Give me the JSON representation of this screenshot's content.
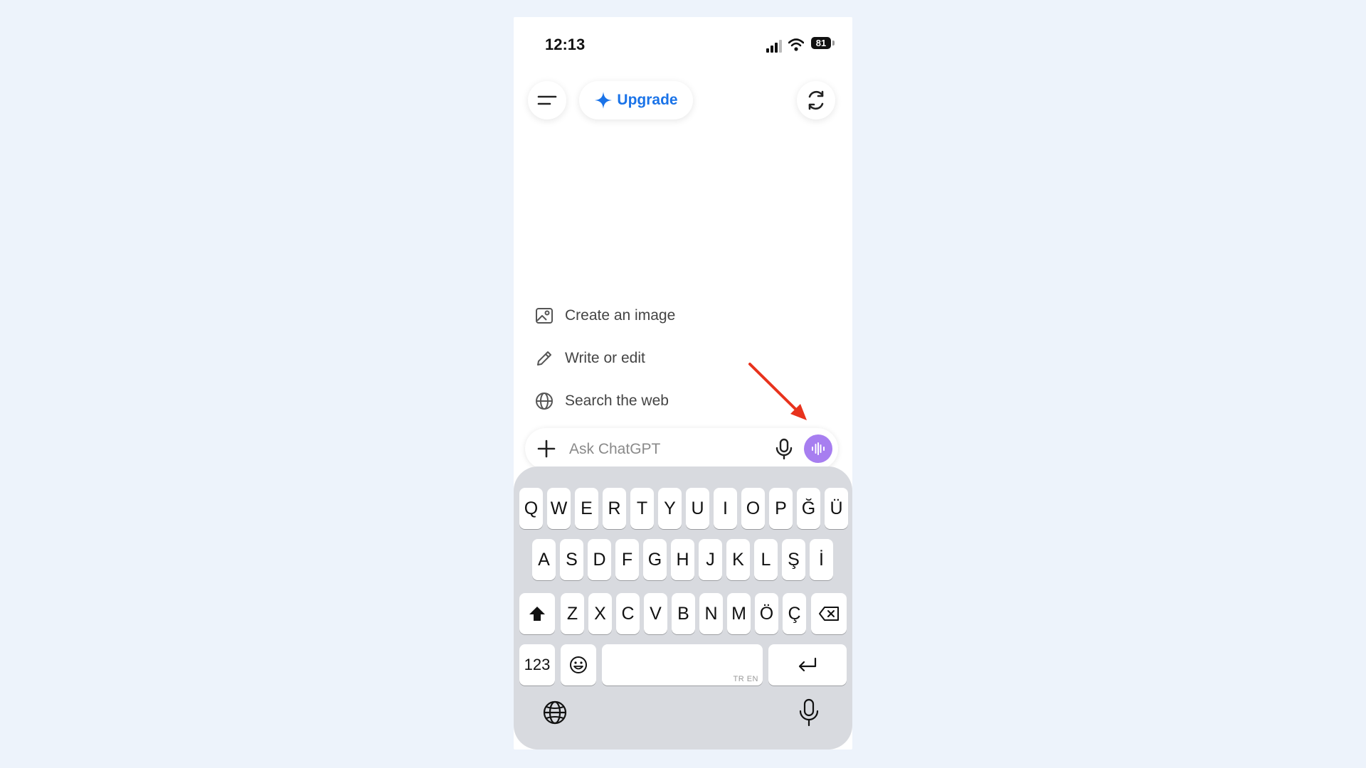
{
  "status": {
    "time": "12:13",
    "battery": "81"
  },
  "header": {
    "upgrade_label": "Upgrade"
  },
  "suggestions": [
    {
      "label": "Create an image",
      "icon": "image-icon"
    },
    {
      "label": "Write or edit",
      "icon": "pencil-icon"
    },
    {
      "label": "Search the web",
      "icon": "globe-icon"
    }
  ],
  "composer": {
    "placeholder": "Ask ChatGPT"
  },
  "keyboard": {
    "row1": [
      "Q",
      "W",
      "E",
      "R",
      "T",
      "Y",
      "U",
      "I",
      "O",
      "P",
      "Ğ",
      "Ü"
    ],
    "row2": [
      "A",
      "S",
      "D",
      "F",
      "G",
      "H",
      "J",
      "K",
      "L",
      "Ş",
      "İ"
    ],
    "row3": [
      "Z",
      "X",
      "C",
      "V",
      "B",
      "N",
      "M",
      "Ö",
      "Ç"
    ],
    "numbers_label": "123",
    "space_hint": "TR EN"
  },
  "colors": {
    "background": "#edf3fb",
    "accent_blue": "#1a73e8",
    "voice_purple": "#a77ef0",
    "arrow_red": "#e8321c"
  }
}
